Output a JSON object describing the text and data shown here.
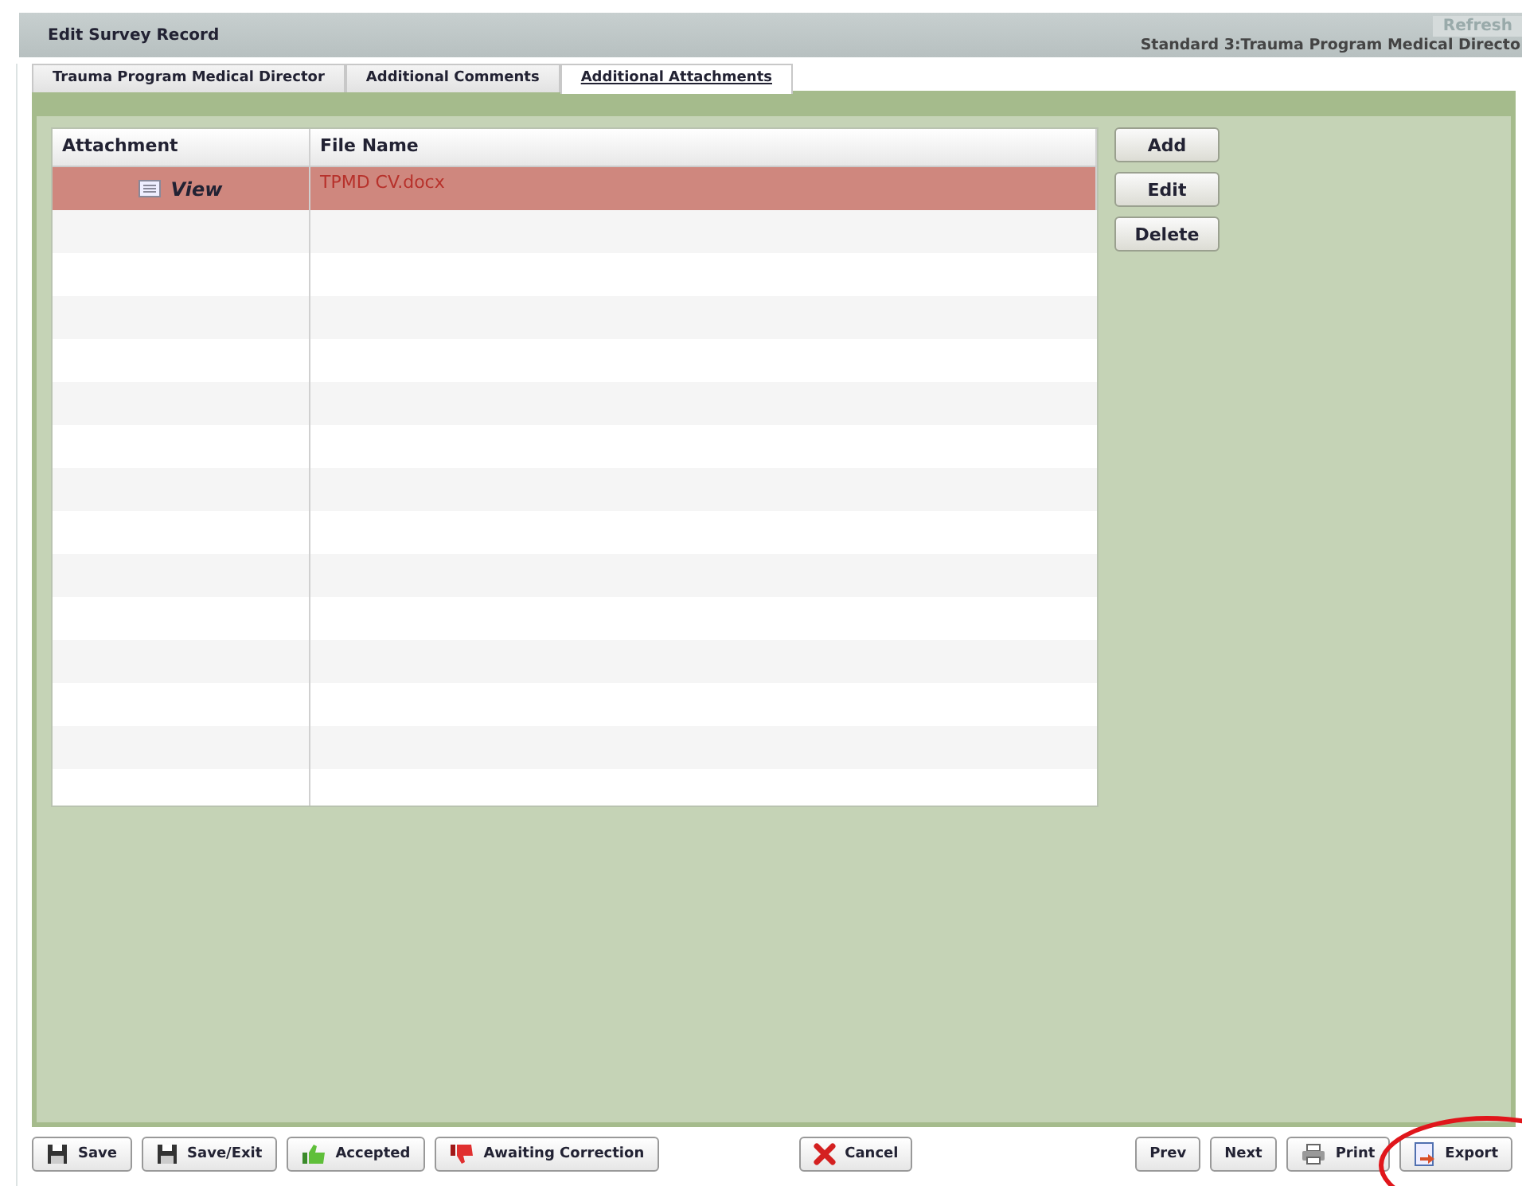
{
  "window": {
    "title": "Edit Survey Record",
    "subtitle": "Standard 3:Trauma Program Medical Directo",
    "refresh": "Refresh"
  },
  "tabs": [
    {
      "label": "Trauma Program Medical Director",
      "selected": false
    },
    {
      "label": "Additional Comments",
      "selected": false
    },
    {
      "label": "Additional Attachments",
      "selected": true
    }
  ],
  "table": {
    "columns": [
      "Attachment",
      "File Name"
    ],
    "rows": [
      {
        "attachment": "View",
        "file_name": "TPMD CV.docx",
        "selected": true
      }
    ]
  },
  "side_buttons": [
    "Add",
    "Edit",
    "Delete"
  ],
  "toolbar_left": [
    "Save",
    "Save/Exit",
    "Accepted",
    "Awaiting Correction"
  ],
  "toolbar_center": [
    "Cancel"
  ],
  "toolbar_right": [
    "Prev",
    "Next",
    "Print",
    "Export"
  ]
}
